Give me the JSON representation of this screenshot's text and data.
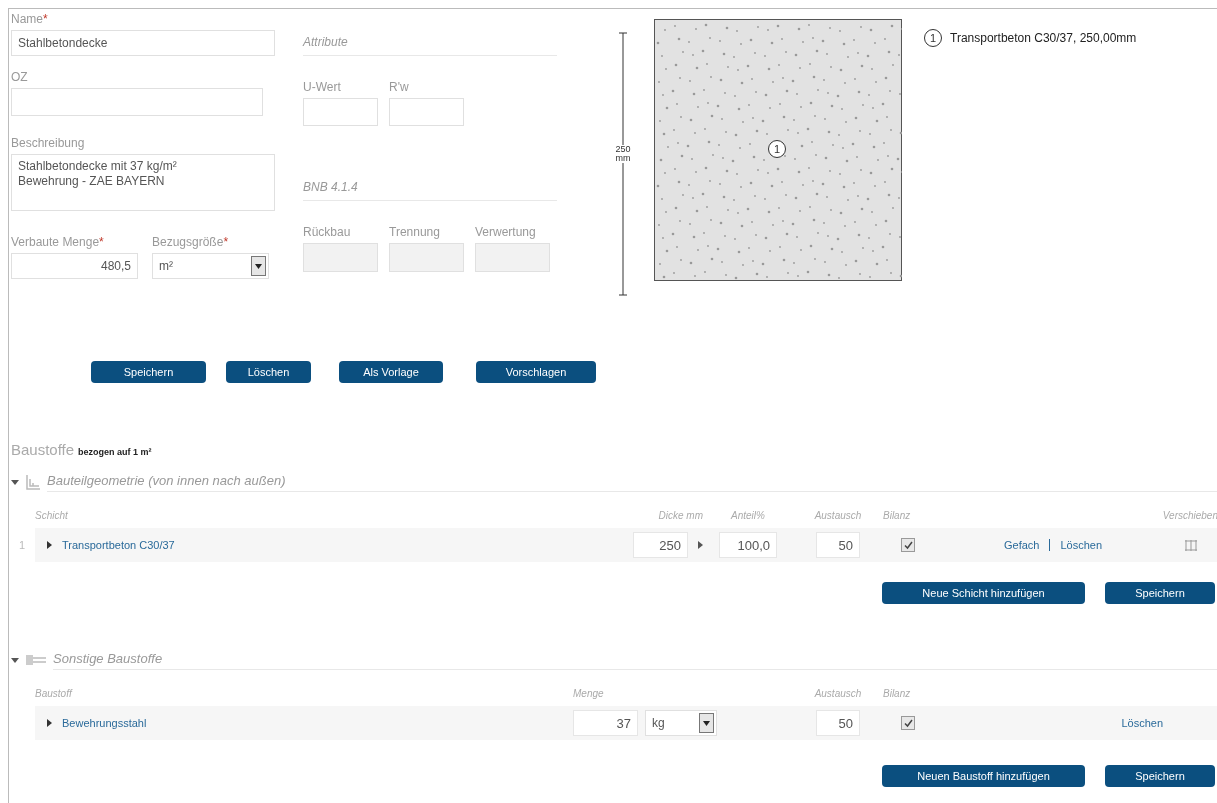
{
  "form": {
    "name": {
      "label": "Name",
      "marker": "*",
      "value": "Stahlbetondecke"
    },
    "oz": {
      "label": "OZ"
    },
    "description": {
      "label": "Beschreibung",
      "value": "Stahlbetondecke mit 37 kg/m² Bewehrung - ZAE BAYERN"
    },
    "quantity": {
      "label": "Verbaute Menge",
      "marker": "*",
      "value": "480,5"
    },
    "unit": {
      "label": "Bezugsgröße",
      "marker": "*",
      "value": "m²"
    }
  },
  "attributes": {
    "title": "Attribute",
    "fields": [
      {
        "label": "U-Wert",
        "disabled": false
      },
      {
        "label": "R'w",
        "disabled": false
      }
    ]
  },
  "bnb": {
    "title": "BNB 4.1.4",
    "fields": [
      {
        "label": "Rückbau",
        "disabled": true
      },
      {
        "label": "Trennung",
        "disabled": true
      },
      {
        "label": "Verwertung",
        "disabled": true
      }
    ]
  },
  "actions": [
    "Speichern",
    "Löschen",
    "Als Vorlage",
    "Vorschlagen"
  ],
  "drawing": {
    "dimension": "250",
    "dimension_unit": "mm",
    "layer_marker": "1",
    "legend": [
      {
        "marker": "1",
        "text": "Transportbeton C30/37, 250,00mm"
      }
    ]
  },
  "materials": {
    "title": "Baustoffe",
    "subtitle": "bezogen auf 1 m²",
    "sections": [
      {
        "kind": "layers",
        "title": "Bauteilgeometrie (von innen nach außen)",
        "expanded": true,
        "columns": [
          "Schicht",
          "Dicke mm",
          "Anteil%",
          "Austausch",
          "Bilanz",
          "Verschieben"
        ],
        "rows": [
          {
            "index": "1",
            "name": "Transportbeton C30/37",
            "expanded": false,
            "thickness": "250",
            "share": "100,0",
            "exchange": "50",
            "balance": true,
            "actions": [
              "Gefach",
              "Löschen"
            ]
          }
        ],
        "buttons": [
          "Neue Schicht hinzufügen",
          "Speichern"
        ]
      },
      {
        "kind": "other",
        "title": "Sonstige Baustoffe",
        "expanded": true,
        "columns": [
          "Baustoff",
          "Menge",
          "Austausch",
          "Bilanz"
        ],
        "rows": [
          {
            "name": "Bewehrungsstahl",
            "expanded": false,
            "amount": "37",
            "unit": "kg",
            "exchange": "50",
            "balance": true,
            "actions": [
              "Löschen"
            ]
          }
        ],
        "buttons": [
          "Neuen Baustoff hinzufügen",
          "Speichern"
        ]
      }
    ]
  }
}
